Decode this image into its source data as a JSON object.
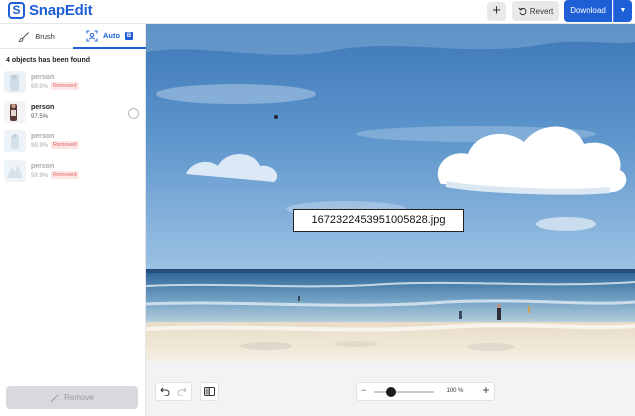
{
  "app": {
    "name": "SnapEdit",
    "logo_letter": "S",
    "brand_color": "#1f5fd6"
  },
  "toolbar": {
    "add_label": "+",
    "revert_label": "Revert",
    "download_label": "Download"
  },
  "tabs": [
    {
      "label": "Brush",
      "icon": "brush-icon",
      "active": false
    },
    {
      "label": "Auto",
      "icon": "auto-select-icon",
      "badge": "B",
      "active": true
    }
  ],
  "objects_found_label": "4 objects has been found",
  "objects": [
    {
      "label": "person",
      "score": "99.9%",
      "status": "Removed"
    },
    {
      "label": "person",
      "score": "97.5%",
      "status": ""
    },
    {
      "label": "person",
      "score": "99.9%",
      "status": "Removed"
    },
    {
      "label": "person",
      "score": "99.9%",
      "status": "Removed"
    }
  ],
  "remove_button_label": "Remove",
  "canvas": {
    "filename": "1672322453951005828.jpg"
  },
  "zoom": {
    "minus": "−",
    "value": "100 %",
    "plus": "+",
    "level": 0.2
  }
}
